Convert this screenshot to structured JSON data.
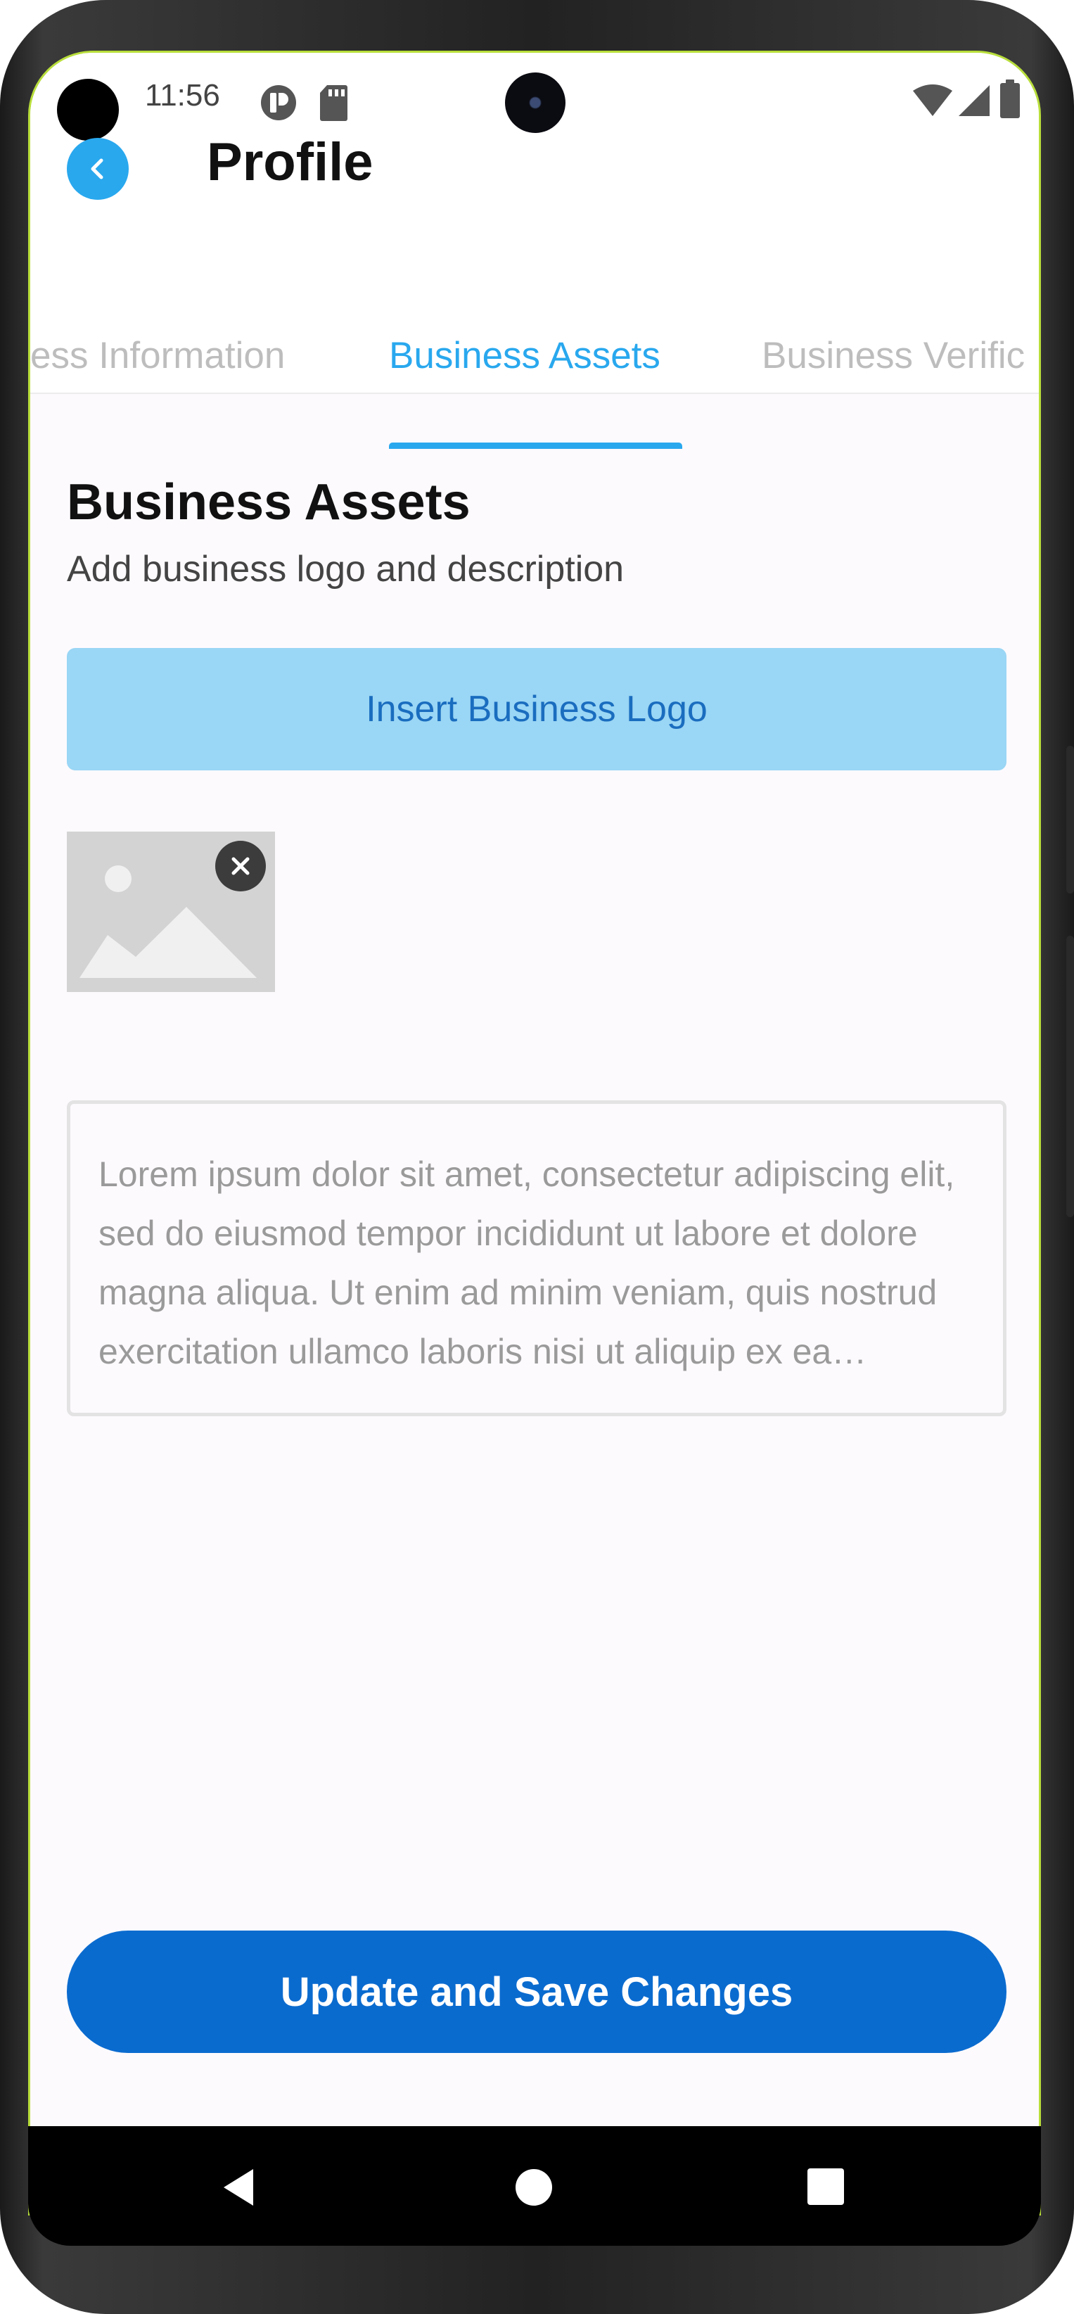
{
  "status_bar": {
    "time": "11:56",
    "icons": [
      "app-notification-icon",
      "sd-card-icon",
      "wifi-icon",
      "cell-signal-icon",
      "battery-icon"
    ]
  },
  "app_bar": {
    "title": "Profile",
    "back_icon": "chevron-left-icon"
  },
  "tabs": [
    {
      "label": "ess Information",
      "active": false
    },
    {
      "label": "Business Assets",
      "active": true
    },
    {
      "label": "Business Verific",
      "active": false
    }
  ],
  "section": {
    "title": "Business Assets",
    "subtitle": "Add business logo and description"
  },
  "insert_logo_button": {
    "label": "Insert Business Logo"
  },
  "logo_preview": {
    "icon": "image-placeholder-icon",
    "remove_icon": "close-icon"
  },
  "description": {
    "text": "Lorem ipsum dolor sit amet, consectetur adipiscing elit, sed do eiusmod tempor incididunt ut labore et dolore magna aliqua. Ut enim ad minim veniam, quis nostrud exercitation ullamco laboris nisi ut aliquip ex ea commodo consequat."
  },
  "save_button": {
    "label": "Update and Save Changes"
  },
  "navigation": {
    "icons": [
      "back-triangle-icon",
      "home-circle-icon",
      "recents-square-icon"
    ]
  },
  "colors": {
    "accent": "#29a8ee",
    "primary_button": "#0a6bcf",
    "insert_button_bg": "#9ad6f5",
    "screen_bg": "#fdfafd"
  }
}
